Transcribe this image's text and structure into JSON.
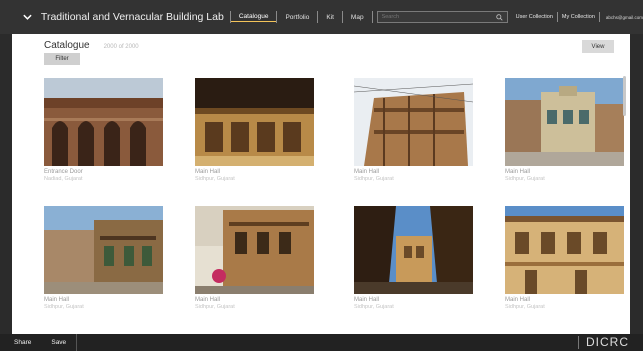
{
  "app": {
    "title": "Traditional and Vernacular Building Lab"
  },
  "nav": {
    "items": [
      "Catalogue",
      "Portfolio",
      "Kit",
      "Map"
    ],
    "active": "Catalogue"
  },
  "search": {
    "placeholder": "Search"
  },
  "user_nav": {
    "user_collection": "User Collection",
    "my_collection": "My Collection",
    "email": "abchs@gmail.com"
  },
  "catalogue": {
    "heading": "Catalogue",
    "count": "2000 of 2000",
    "filter_label": "Filter",
    "view_label": "View"
  },
  "cards": [
    {
      "title": "Entrance Door",
      "location": "Nadiad, Gujarat",
      "icon": "photo-entrance-door"
    },
    {
      "title": "Main Hall",
      "location": "Sidhpur, Gujarat",
      "icon": "photo-main-hall"
    },
    {
      "title": "Main Hall",
      "location": "Sidhpur, Gujarat",
      "icon": "photo-main-hall"
    },
    {
      "title": "Main Hall",
      "location": "Sidhpur, Gujarat",
      "icon": "photo-main-hall"
    },
    {
      "title": "Main Hall",
      "location": "Sidhpur, Gujarat",
      "icon": "photo-main-hall"
    },
    {
      "title": "Main Hall",
      "location": "Sidhpur, Gujarat",
      "icon": "photo-main-hall"
    },
    {
      "title": "Main Hall",
      "location": "Sidhpur, Gujarat",
      "icon": "photo-main-hall"
    },
    {
      "title": "Main Hall",
      "location": "Sidhpur, Gujarat",
      "icon": "photo-main-hall"
    }
  ],
  "footer": {
    "share_label": "Share",
    "save_label": "Save",
    "logo_text": "DICRC"
  },
  "colors": {
    "topbar": "#333333",
    "footer": "#222222",
    "accent": "#f4c45a"
  }
}
